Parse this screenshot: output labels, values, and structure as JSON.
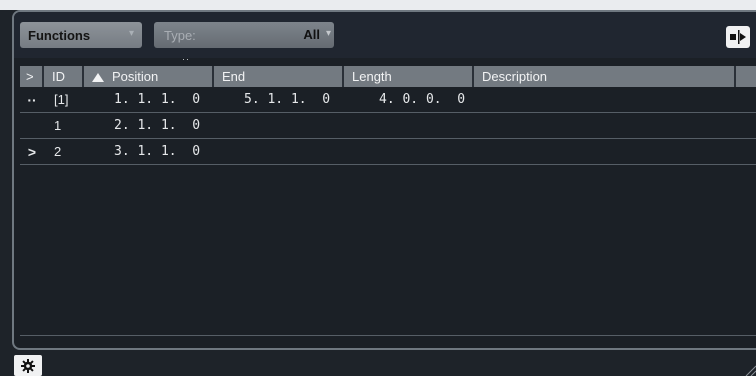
{
  "toolbar": {
    "functions_label": "Functions",
    "type_label": "Type:",
    "type_value": "All",
    "caret": "▾"
  },
  "table": {
    "headers": {
      "expand": ">",
      "id": "ID",
      "position": "Position",
      "end": "End",
      "length": "Length",
      "description": "Description"
    },
    "rows": [
      {
        "marker": "··",
        "id": "[1]",
        "position": "1. 1. 1.  0",
        "end": "5. 1. 1.  0",
        "length": "4. 0. 0.  0",
        "description": ""
      },
      {
        "marker": "",
        "id": "1",
        "position": "2. 1. 1.  0",
        "end": "",
        "length": "",
        "description": ""
      },
      {
        "marker": ">",
        "id": "2",
        "position": "3. 1. 1.  0",
        "end": "",
        "length": "",
        "description": ""
      }
    ]
  },
  "icons": {
    "toolbar_right": "transfer-icon",
    "bottom_left": "gear-icon"
  }
}
